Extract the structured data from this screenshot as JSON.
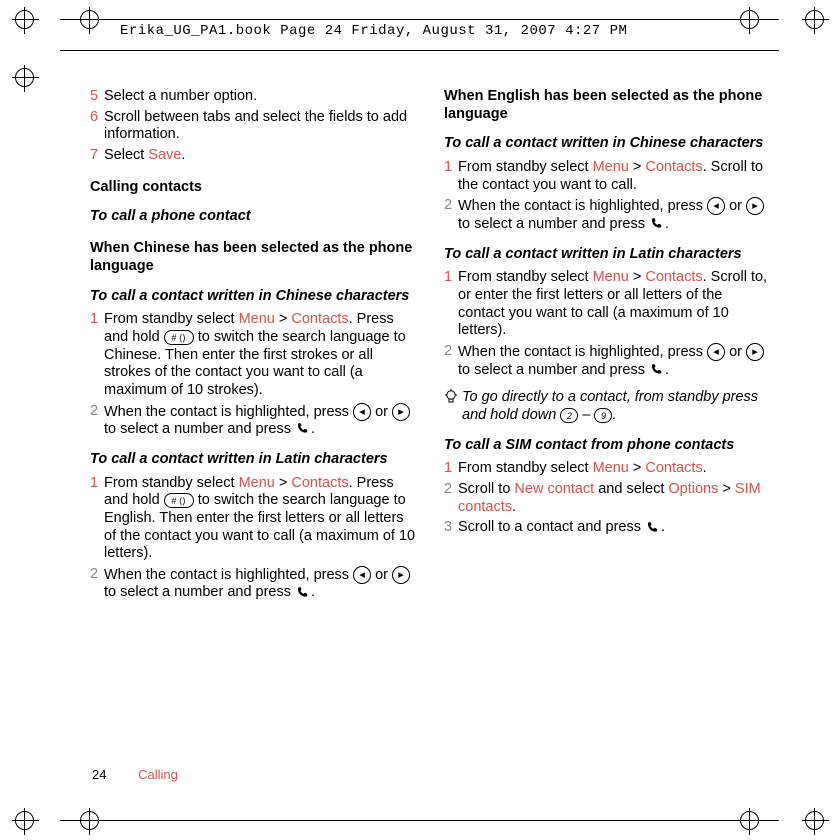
{
  "header_text": "Erika_UG_PA1.book  Page 24  Friday, August 31, 2007  4:27 PM",
  "footer": {
    "page_number": "24",
    "section": "Calling"
  },
  "keys": {
    "hash": "# ⟨⟩",
    "left_arrow": "◂",
    "right_arrow": "▸",
    "two": "2",
    "nine": "9"
  },
  "col1": {
    "step5": {
      "n": "5",
      "t": "Select a number option."
    },
    "step6": {
      "n": "6",
      "t": "Scroll between tabs and select the fields to add information."
    },
    "step7": {
      "n": "7",
      "t_pre": "Select ",
      "link": "Save",
      "t_post": "."
    },
    "h_calling": "Calling contacts",
    "h_tocall": "To call a phone contact",
    "h_chinese_lang": "When Chinese has been selected as the phone language",
    "h_chinese_chars": "To call a contact written in Chinese characters",
    "cc_step1": {
      "n": "1",
      "pre": "From standby select ",
      "menu": "Menu",
      "gt": " > ",
      "contacts": "Contacts",
      "mid1": ". Press and hold ",
      "mid2": " to switch the search language to Chinese. Then enter the first strokes or all strokes of the contact you want to call (a maximum of 10 strokes)."
    },
    "cc_step2": {
      "n": "2",
      "pre": "When the contact is highlighted, press ",
      "mid": " or ",
      "post": " to select a number and press "
    },
    "h_latin": "To call a contact written in Latin characters",
    "lat_step1": {
      "n": "1",
      "pre": "From standby select ",
      "menu": "Menu",
      "gt": " > ",
      "contacts": "Contacts",
      "mid1": ". Press and hold ",
      "mid2": " to switch the search language to English. Then enter the first letters or all letters of the contact you want to call (a maximum of 10 letters)."
    },
    "lat_step2": {
      "n": "2",
      "pre": "When the contact is highlighted, press ",
      "mid": " or ",
      "post": " to select a number and press "
    }
  },
  "col2": {
    "h_english_lang": "When English has been selected as the phone language",
    "h_chinese_chars2": "To call a contact written in Chinese characters",
    "en_cc_step1": {
      "n": "1",
      "pre": "From standby select ",
      "menu": "Menu",
      "gt": " > ",
      "contacts": "Contacts",
      "post": ". Scroll to the contact you want to call."
    },
    "en_cc_step2": {
      "n": "2",
      "pre": "When the contact is highlighted, press ",
      "mid": " or ",
      "post": " to select a number and press "
    },
    "h_latin2": "To call a contact written in Latin characters",
    "en_lat_step1": {
      "n": "1",
      "pre": "From standby select ",
      "menu": "Menu",
      "gt": " > ",
      "contacts": "Contacts",
      "post": ". Scroll to, or enter the first letters or all letters of the contact you want to call (a maximum of 10 letters)."
    },
    "en_lat_step2": {
      "n": "2",
      "pre": "When the contact is highlighted, press ",
      "mid": " or ",
      "post": " to select a number and press "
    },
    "tip": {
      "pre": "To go directly to a contact, from standby press and hold down ",
      "dash": " – ",
      "post": "."
    },
    "h_sim": "To call a SIM contact from phone contacts",
    "sim_step1": {
      "n": "1",
      "pre": "From standby select ",
      "menu": "Menu",
      "gt": " > ",
      "contacts": "Contacts",
      "post": "."
    },
    "sim_step2": {
      "n": "2",
      "pre": "Scroll to ",
      "newc": "New contact",
      "mid": " and select ",
      "opt": "Options",
      "gt": " > ",
      "simc": "SIM contacts",
      "post": "."
    },
    "sim_step3": {
      "n": "3",
      "pre": "Scroll to a contact and press ",
      "post": "."
    }
  }
}
